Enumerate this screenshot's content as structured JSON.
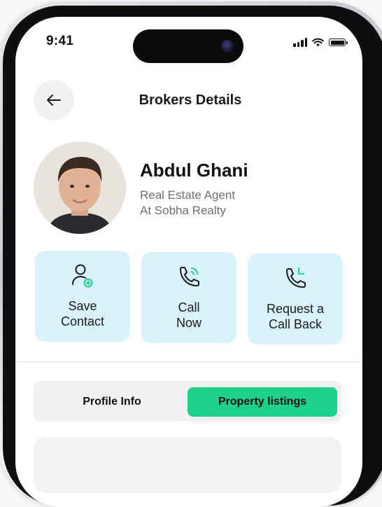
{
  "status_bar": {
    "time": "9:41"
  },
  "header": {
    "back_icon": "arrow-left-icon",
    "title": "Brokers Details"
  },
  "broker": {
    "name": "Abdul Ghani",
    "role_line1": "Real Estate Agent",
    "role_line2": "At Sobha Realty"
  },
  "actions": [
    {
      "label": "Save\nContact",
      "icon": "user-add-icon"
    },
    {
      "label": "Call\nNow",
      "icon": "phone-call-icon"
    },
    {
      "label": "Request a\nCall Back",
      "icon": "phone-callback-icon"
    }
  ],
  "tabs": [
    {
      "label": "Profile Info",
      "active": false
    },
    {
      "label": "Property listings",
      "active": true
    }
  ],
  "colors": {
    "accent_green": "#1ed08a",
    "action_bg": "#d9f2fb",
    "icon_green": "#1ed08a"
  }
}
